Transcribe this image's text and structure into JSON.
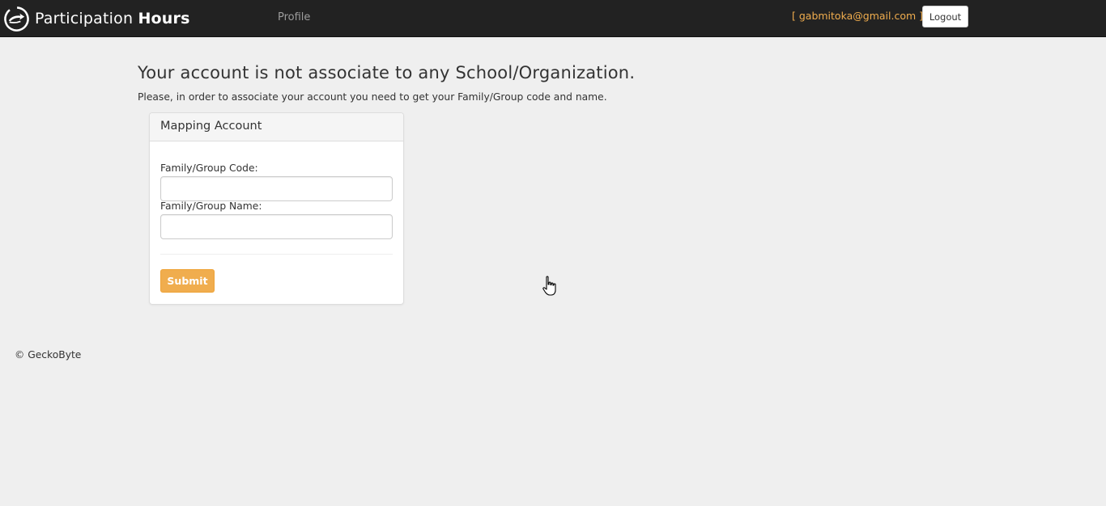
{
  "navbar": {
    "brand_light": "Participation ",
    "brand_bold": "Hours",
    "brand_logo_icon": "circular-arrow-hand-logo-icon",
    "profile_link": "Profile",
    "user_email": "[ gabmitoka@gmail.com ]",
    "logout_label": "Logout"
  },
  "main": {
    "heading": "Your account is not associate to any School/Organization.",
    "subtext": "Please, in order to associate your account you need to get your Family/Group code and name."
  },
  "panel": {
    "title": "Mapping Account",
    "code_label": "Family/Group Code:",
    "code_value": "",
    "name_label": "Family/Group Name:",
    "name_value": "",
    "submit_label": "Submit"
  },
  "footer": {
    "copyright": "© GeckoByte"
  },
  "colors": {
    "navbar_bg": "#222222",
    "accent_orange": "#f0ad4e",
    "page_bg": "#efefef"
  }
}
